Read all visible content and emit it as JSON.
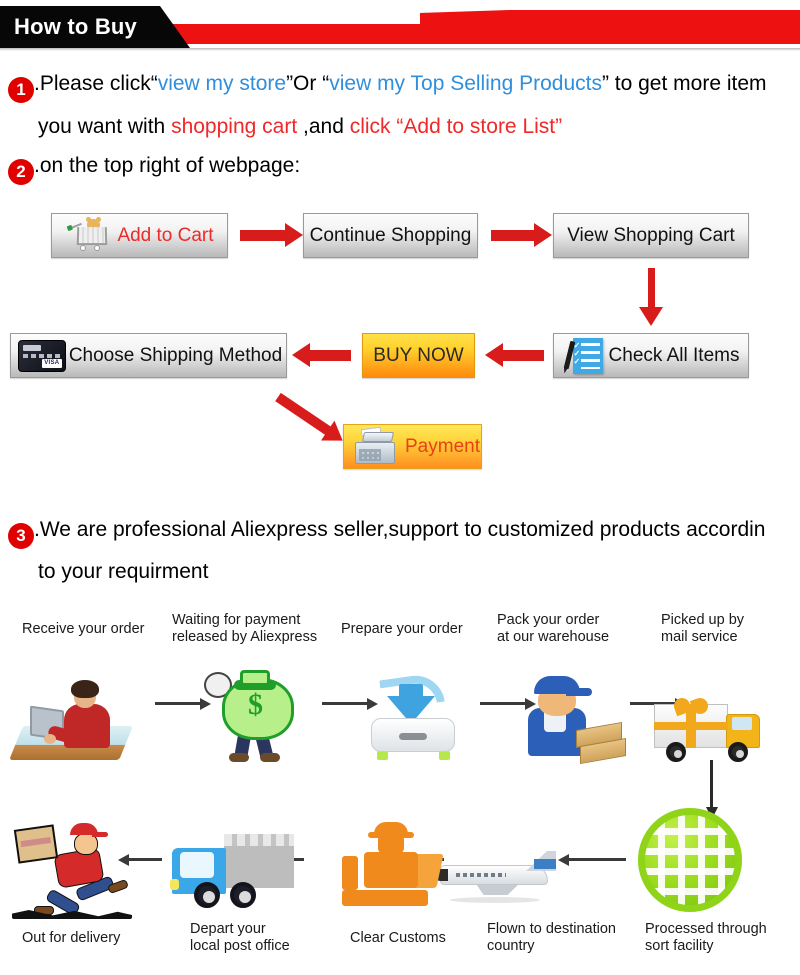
{
  "banner": {
    "title": "How to Buy"
  },
  "colors": {
    "banner_black": "#070707",
    "banner_red": "#ee1111",
    "arrow_red": "#d81c1c",
    "link_blue": "#2f8fdd",
    "highlight_red": "#ef2929",
    "buy_now_orange": "#ffa41b",
    "globe_green": "#9bdc1e"
  },
  "steps": {
    "one": {
      "number": "1",
      "line1_a": ".Please click“",
      "line1_link1": "view my store",
      "line1_b": "”Or “",
      "line1_link2": "view my Top Selling Products",
      "line1_c": "” to get more item",
      "line2_a": "you want with ",
      "line2_red1": "shopping cart",
      "line2_b": " ,and ",
      "line2_red2": "click “Add to store List”"
    },
    "two": {
      "number": "2",
      "text": ".on the top right of webpage:"
    },
    "three": {
      "number": "3",
      "line1": ".We are professional Aliexpress seller,support to customized products accordin",
      "line2": "to your requirment"
    }
  },
  "flow": {
    "add_to_cart": "Add to Cart",
    "continue_shopping": "Continue Shopping",
    "view_shopping_cart": "View Shopping Cart",
    "check_all_items": "Check All Items",
    "buy_now": "BUY NOW",
    "choose_shipping_method": "Choose Shipping Method",
    "payment": "Payment"
  },
  "process": {
    "top_row": [
      {
        "label": "Receive your order",
        "icon": "person-at-computer-icon"
      },
      {
        "label": "Waiting for payment\nreleased by Aliexpress",
        "line1": "Waiting for payment",
        "line2": "released by Aliexpress",
        "icon": "money-bag-icon"
      },
      {
        "label": "Prepare your order",
        "icon": "download-box-icon"
      },
      {
        "label": "Pack your order\nat our warehouse",
        "line1": "Pack your order",
        "line2": "at our warehouse",
        "icon": "warehouse-worker-icon"
      },
      {
        "label": "Picked up by\nmail service",
        "line1": "Picked up by",
        "line2": "mail service",
        "icon": "delivery-truck-gift-icon"
      }
    ],
    "bottom_row": [
      {
        "label": "Out for delivery",
        "icon": "running-courier-icon"
      },
      {
        "label": "Depart your\nlocal post office",
        "line1": "Depart your",
        "line2": "local post office",
        "icon": "blue-truck-icon"
      },
      {
        "label": "Clear Customs",
        "icon": "customs-officer-icon"
      },
      {
        "label": "Flown to destination\ncountry",
        "line1": "Flown to destination",
        "line2": "country",
        "icon": "airplane-icon"
      },
      {
        "label": "Processed through\nsort facility",
        "line1": "Processed through",
        "line2": "sort facility",
        "icon": "globe-sort-facility-icon"
      }
    ]
  }
}
